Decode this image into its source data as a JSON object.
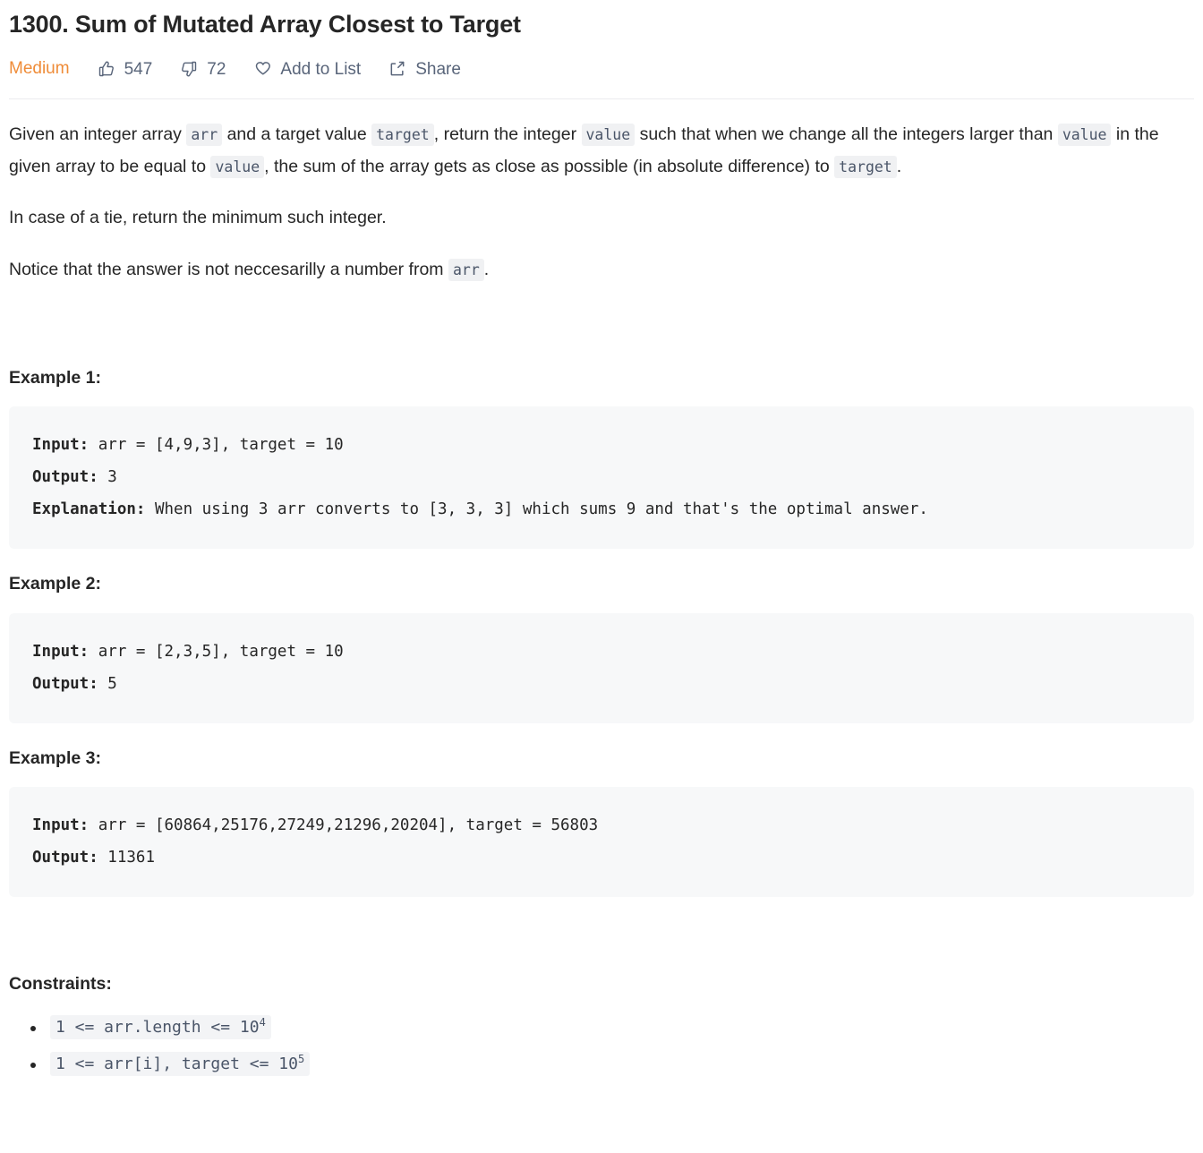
{
  "problem": {
    "title": "1300. Sum of Mutated Array Closest to Target",
    "difficulty": "Medium"
  },
  "actions": {
    "likes": "547",
    "dislikes": "72",
    "add_to_list": "Add to List",
    "share": "Share"
  },
  "description": {
    "p1": {
      "t1": "Given an integer array ",
      "c1": "arr",
      "t2": " and a target value ",
      "c2": "target",
      "t3": ", return the integer ",
      "c3": "value",
      "t4": " such that when we change all the integers larger than ",
      "c4": "value",
      "t5": " in the given array to be equal to ",
      "c5": "value",
      "t6": ", the sum of the array gets as close as possible (in absolute difference) to ",
      "c6": "target",
      "t7": "."
    },
    "p2": "In case of a tie, return the minimum such integer.",
    "p3": {
      "t1": "Notice that the answer is not neccesarilly a number from ",
      "c1": "arr",
      "t2": "."
    }
  },
  "examples": [
    {
      "heading": "Example 1:",
      "input_label": "Input:",
      "input_value": " arr = [4,9,3], target = 10",
      "output_label": "Output:",
      "output_value": " 3",
      "explanation_label": "Explanation:",
      "explanation_value": " When using 3 arr converts to [3, 3, 3] which sums 9 and that's the optimal answer."
    },
    {
      "heading": "Example 2:",
      "input_label": "Input:",
      "input_value": " arr = [2,3,5], target = 10",
      "output_label": "Output:",
      "output_value": " 5",
      "explanation_label": "",
      "explanation_value": ""
    },
    {
      "heading": "Example 3:",
      "input_label": "Input:",
      "input_value": " arr = [60864,25176,27249,21296,20204], target = 56803",
      "output_label": "Output:",
      "output_value": " 11361",
      "explanation_label": "",
      "explanation_value": ""
    }
  ],
  "constraints": {
    "heading": "Constraints:",
    "items": [
      {
        "base": "1 <= arr.length <= 10",
        "exp": "4"
      },
      {
        "base": "1 <= arr[i], target <= 10",
        "exp": "5"
      }
    ]
  },
  "colors": {
    "difficulty_medium": "#ef8c38",
    "action_text": "#59657a",
    "body_text": "#262626",
    "code_bg": "#f7f8f9",
    "inline_code_bg": "#f0f1f3"
  }
}
